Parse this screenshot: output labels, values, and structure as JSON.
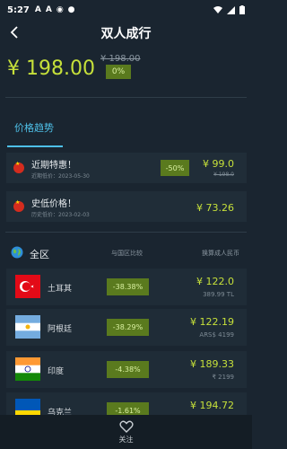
{
  "statusbar": {
    "time": "5:27",
    "icons": [
      "A",
      "A",
      "◉",
      "●"
    ]
  },
  "header": {
    "title": "双人成行"
  },
  "price": {
    "current": "¥ 198.00",
    "original": "¥ 198.00",
    "discount": "0%"
  },
  "tabs": [
    {
      "label": "价格趋势"
    }
  ],
  "history": [
    {
      "name": "近期特惠！",
      "sub": "近期低价：2023-05-30",
      "badge": "-50%",
      "price": "¥ 99.0",
      "price_sub": "¥ 198.0"
    },
    {
      "name": "史低价格！",
      "sub": "历史低价：2023-02-03",
      "price": "¥ 73.26"
    }
  ],
  "regions_header": {
    "label": "全区",
    "col1": "与国区比较",
    "col2": "换算成人民币"
  },
  "regions": [
    {
      "name": "土耳其",
      "badge": "-38.38%",
      "price": "¥ 122.0",
      "sub": "389.99 TL"
    },
    {
      "name": "阿根廷",
      "badge": "-38.29%",
      "price": "¥ 122.19",
      "sub": "ARS$ 4199"
    },
    {
      "name": "印度",
      "badge": "-4.38%",
      "price": "¥ 189.33",
      "sub": "₹ 2199"
    },
    {
      "name": "乌克兰",
      "badge": "-1.61%",
      "price": "¥ 194.72",
      "sub": ""
    }
  ],
  "bottom": {
    "follow_label": "关注"
  }
}
